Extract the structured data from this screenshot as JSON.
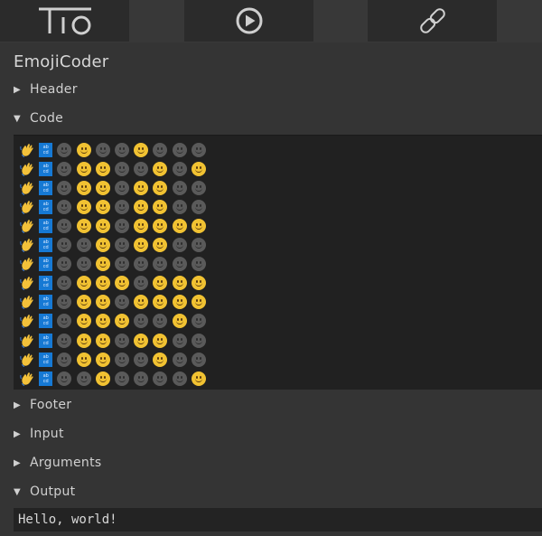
{
  "topbar": {
    "home_label": "TIO",
    "home_icon": "tio-logo",
    "run_icon": "play-circle-icon",
    "link_icon": "chain-link-icon"
  },
  "language": {
    "name": "EmojiCoder"
  },
  "sections": {
    "header": {
      "label": "Header",
      "expanded": false,
      "arrow": "▶"
    },
    "code": {
      "label": "Code",
      "expanded": true,
      "arrow": "▼"
    },
    "footer": {
      "label": "Footer",
      "expanded": false,
      "arrow": "▶"
    },
    "input": {
      "label": "Input",
      "expanded": false,
      "arrow": "▶"
    },
    "arguments": {
      "label": "Arguments",
      "expanded": false,
      "arrow": "▶"
    },
    "output": {
      "label": "Output",
      "expanded": true,
      "arrow": "▼"
    }
  },
  "code": {
    "prefix_icons": [
      "waving-hand-emoji",
      "abcd-input-symbol"
    ],
    "abcd_text": [
      "ab",
      "cd"
    ],
    "legend": {
      "1": "slightly-smiling-face (yellow)",
      "0": "slightly-smiling-face (gray)"
    },
    "rows": [
      "01001000",
      "01100101",
      "01101100",
      "01101100",
      "01101111",
      "00101100",
      "00100000",
      "01110111",
      "01101111",
      "01110010",
      "01101100",
      "01100100",
      "00100001"
    ]
  },
  "output": {
    "text": "Hello, world!"
  },
  "colors": {
    "background": "#343434",
    "panel": "#2b2b2b",
    "code_bg": "#212121",
    "abcd_blue": "#1679d4",
    "smiley_on": "#f1c232",
    "smiley_off": "#5a5a5a"
  }
}
